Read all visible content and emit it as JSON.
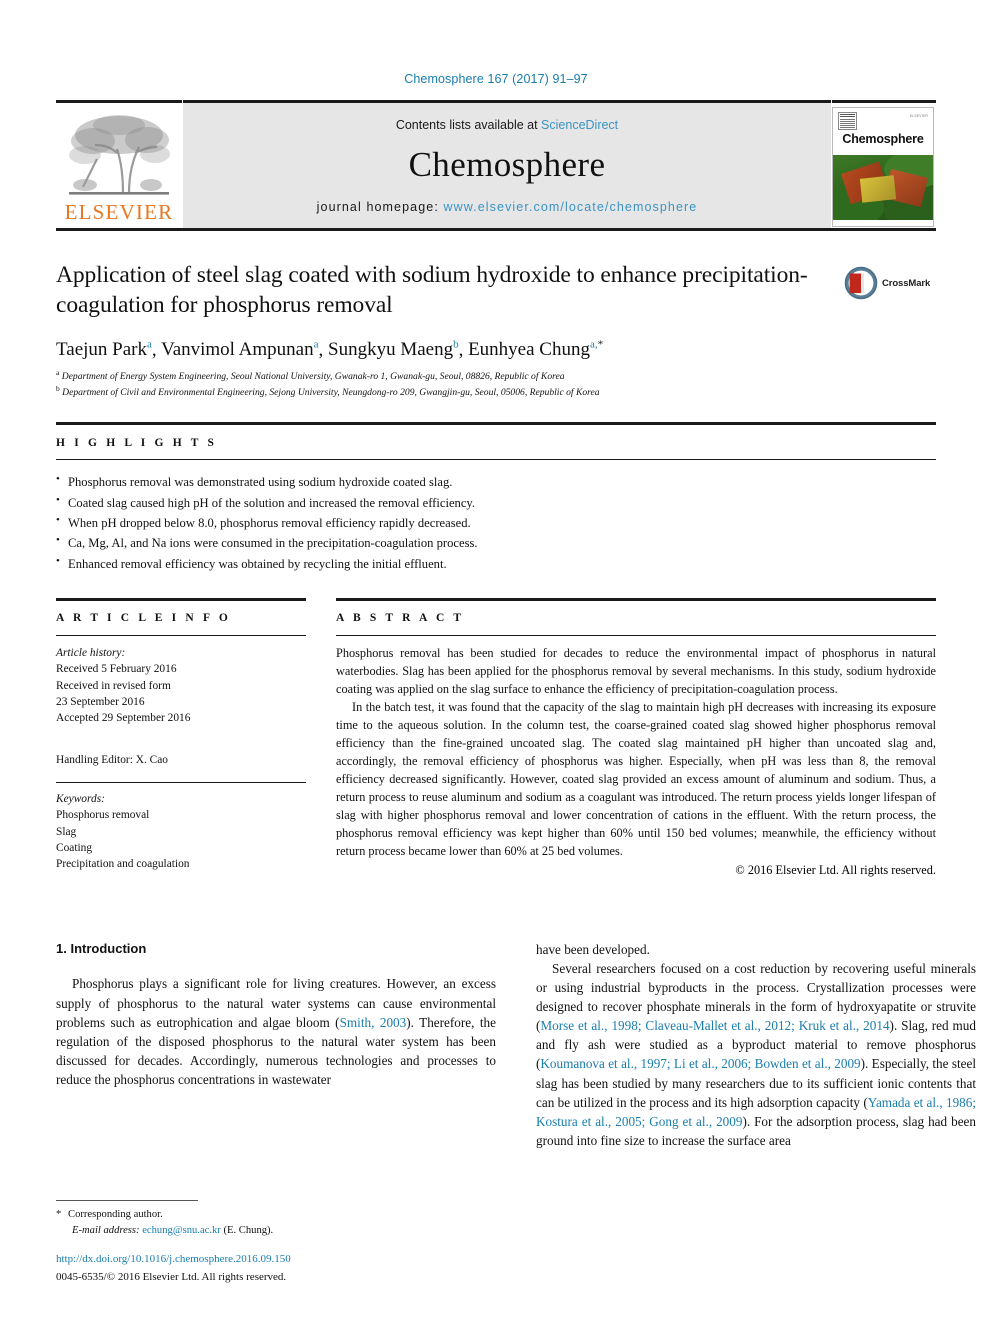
{
  "running_head": "Chemosphere 167 (2017) 91–97",
  "masthead": {
    "publisher_logo_text": "ELSEVIER",
    "contents_prefix": "Contents lists available at ",
    "contents_link": "ScienceDirect",
    "journal_name": "Chemosphere",
    "homepage_prefix": "journal homepage: ",
    "homepage_url": "www.elsevier.com/locate/chemosphere",
    "cover_title": "Chemosphere",
    "cover_mini_text": "ELSEVIER"
  },
  "article": {
    "title": "Application of steel slag coated with sodium hydroxide to enhance precipitation-coagulation for phosphorus removal",
    "crossmark_label": "CrossMark",
    "authors": [
      {
        "name": "Taejun Park",
        "sup": "a",
        "sep": ", "
      },
      {
        "name": "Vanvimol Ampunan",
        "sup": "a",
        "sep": ", "
      },
      {
        "name": "Sungkyu Maeng",
        "sup": "b",
        "sep": ", "
      },
      {
        "name": "Eunhyea Chung",
        "sup": "a,",
        "star": "*",
        "sep": ""
      }
    ],
    "affiliations": [
      {
        "marker": "a",
        "text": "Department of Energy System Engineering, Seoul National University, Gwanak-ro 1, Gwanak-gu, Seoul, 08826, Republic of Korea"
      },
      {
        "marker": "b",
        "text": "Department of Civil and Environmental Engineering, Sejong University, Neungdong-ro 209, Gwangjin-gu, Seoul, 05006, Republic of Korea"
      }
    ]
  },
  "highlights": {
    "label": "H I G H L I G H T S",
    "items": [
      "Phosphorus removal was demonstrated using sodium hydroxide coated slag.",
      "Coated slag caused high pH of the solution and increased the removal efficiency.",
      "When pH dropped below 8.0, phosphorus removal efficiency rapidly decreased.",
      "Ca, Mg, Al, and Na ions were consumed in the precipitation-coagulation process.",
      "Enhanced removal efficiency was obtained by recycling the initial effluent."
    ]
  },
  "article_info": {
    "label": "A R T I C L E   I N F O",
    "history_label": "Article history:",
    "history": [
      "Received 5 February 2016",
      "Received in revised form",
      "23 September 2016",
      "Accepted 29 September 2016"
    ],
    "handling_editor": "Handling Editor: X. Cao",
    "keywords_label": "Keywords:",
    "keywords": [
      "Phosphorus removal",
      "Slag",
      "Coating",
      "Precipitation and coagulation"
    ]
  },
  "abstract": {
    "label": "A B S T R A C T",
    "paragraph1": "Phosphorus removal has been studied for decades to reduce the environmental impact of phosphorus in natural waterbodies. Slag has been applied for the phosphorus removal by several mechanisms. In this study, sodium hydroxide coating was applied on the slag surface to enhance the efficiency of precipitation-coagulation process.",
    "paragraph2": "In the batch test, it was found that the capacity of the slag to maintain high pH decreases with increasing its exposure time to the aqueous solution. In the column test, the coarse-grained coated slag showed higher phosphorus removal efficiency than the fine-grained uncoated slag. The coated slag maintained pH higher than uncoated slag and, accordingly, the removal efficiency of phosphorus was higher. Especially, when pH was less than 8, the removal efficiency decreased significantly. However, coated slag provided an excess amount of aluminum and sodium. Thus, a return process to reuse aluminum and sodium as a coagulant was introduced. The return process yields longer lifespan of slag with higher phosphorus removal and lower concentration of cations in the effluent. With the return process, the phosphorus removal efficiency was kept higher than 60% until 150 bed volumes; meanwhile, the efficiency without return process became lower than 60% at 25 bed volumes.",
    "copyright": "© 2016 Elsevier Ltd. All rights reserved."
  },
  "introduction": {
    "heading": "1. Introduction",
    "left_paragraph_pre": "Phosphorus plays a significant role for living creatures. However, an excess supply of phosphorus to the natural water systems can cause environmental problems such as eutrophication and algae bloom (",
    "left_ref1": "Smith, 2003",
    "left_paragraph_post": "). Therefore, the regulation of the disposed phosphorus to the natural water system has been discussed for decades. Accordingly, numerous technologies and processes to reduce the phosphorus concentrations in wastewater",
    "right_continuation": "have been developed.",
    "right_p2_a": "Several researchers focused on a cost reduction by recovering useful minerals or using industrial byproducts in the process. Crystallization processes were designed to recover phosphate minerals in the form of hydroxyapatite or struvite (",
    "right_ref1": "Morse et al., 1998; Claveau-Mallet et al., 2012; Kruk et al., 2014",
    "right_p2_b": "). Slag, red mud and fly ash were studied as a byproduct material to remove phosphorus (",
    "right_ref2": "Koumanova et al., 1997; Li et al., 2006; Bowden et al., 2009",
    "right_p2_c": "). Especially, the steel slag has been studied by many researchers due to its sufficient ionic contents that can be utilized in the process and its high adsorption capacity (",
    "right_ref3": "Yamada et al., 1986; Kostura et al., 2005; Gong et al., 2009",
    "right_p2_d": "). For the adsorption process, slag had been ground into fine size to increase the surface area"
  },
  "footer": {
    "corresponding_star": "*",
    "corresponding_label": "Corresponding author.",
    "email_label": "E-mail address:",
    "email": "echung@snu.ac.kr",
    "email_suffix": "(E. Chung).",
    "doi": "http://dx.doi.org/10.1016/j.chemosphere.2016.09.150",
    "issn": "0045-6535/© 2016 Elsevier Ltd. All rights reserved."
  },
  "colors": {
    "link_blue": "#1a7dae",
    "elsevier_orange": "#E87722",
    "masthead_gray": "#e6e6e6"
  }
}
